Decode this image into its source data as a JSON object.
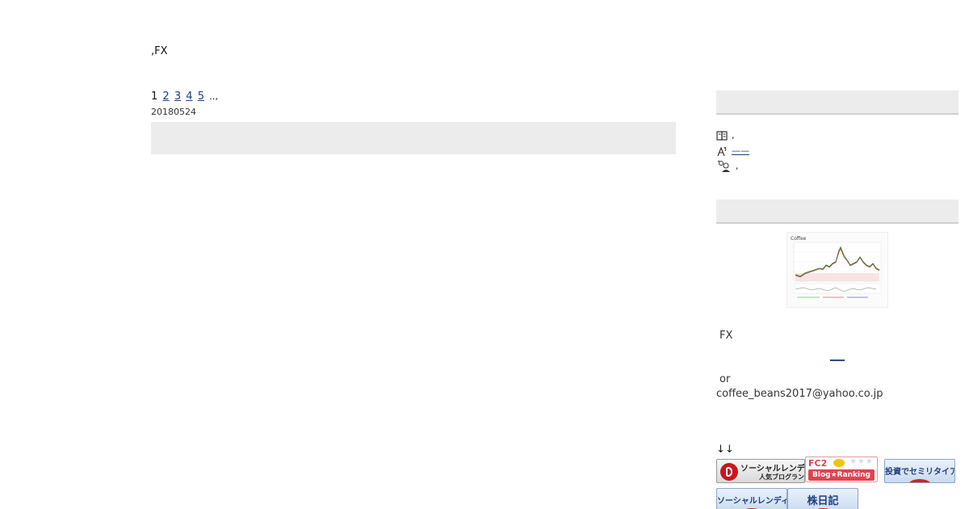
{
  "site": {
    "title": ",FX"
  },
  "pager": {
    "current": "1",
    "pages": [
      "2",
      "3",
      "4",
      "5"
    ],
    "more": "‥,"
  },
  "post": {
    "date": "20180524"
  },
  "sidebar": {
    "links": {
      "row1_text": ",",
      "row2_link": "——",
      "row3_text": ","
    },
    "profile": {
      "fx": "FX",
      "link_text": "___",
      "or": "or",
      "email": "coffee_beans2017@yahoo.co.jp"
    },
    "chart_thumb": {
      "title": "Coffee"
    },
    "arrows": "↓↓",
    "banners": {
      "social_lending_top": "ソーシャルレンディング",
      "social_lending_sub": "人気ブログランキング",
      "fc2_top": "FC2",
      "fc2_stars": "★★★",
      "fc2_bottom": "Blog★Ranking",
      "semi_retire": "投資でセミリタイア生活",
      "social_lending_2": "ソーシャルレンディング",
      "kabu_nikki": "株日記"
    }
  },
  "colors": {
    "link": "#1a3f7a",
    "bar": "#ececec",
    "accent_red": "#d62020"
  }
}
